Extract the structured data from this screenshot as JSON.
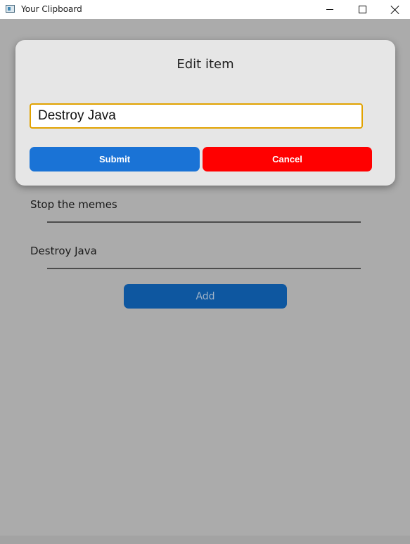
{
  "window": {
    "title": "Your Clipboard",
    "controls": {
      "minimize_icon": "minimize-icon",
      "maximize_icon": "maximize-icon",
      "close_icon": "close-icon"
    }
  },
  "list": {
    "items": [
      {
        "label": "Stop the memes"
      },
      {
        "label": "Destroy Java"
      }
    ],
    "add_label": "Add"
  },
  "modal": {
    "title": "Edit item",
    "input_value": "Destroy Java",
    "submit_label": "Submit",
    "cancel_label": "Cancel"
  },
  "colors": {
    "overlay": "#ababab",
    "modal_bg": "#e6e6e6",
    "input_focus_border": "#e1a200",
    "submit": "#1a73d6",
    "cancel": "#ff0000",
    "add_dimmed": "#0e57a0"
  }
}
